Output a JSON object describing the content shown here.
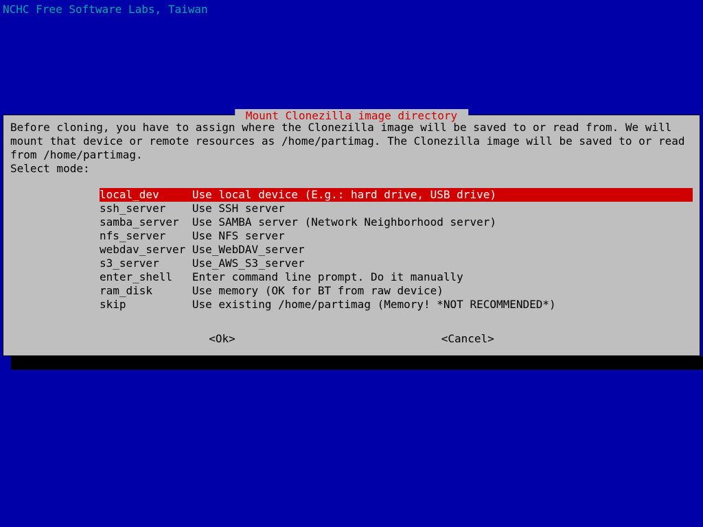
{
  "header": "NCHC Free Software Labs, Taiwan",
  "dialog": {
    "title": " Mount Clonezilla image directory ",
    "body": "Before cloning, you have to assign where the Clonezilla image will be saved to or read from. We will mount that device or remote resources as /home/partimag. The Clonezilla image will be saved to or read from /home/partimag.\nSelect mode:",
    "menu": [
      {
        "key": "local_dev",
        "desc": "Use local device (E.g.: hard drive, USB drive)",
        "selected": true
      },
      {
        "key": "ssh_server",
        "desc": "Use SSH server",
        "selected": false
      },
      {
        "key": "samba_server",
        "desc": "Use SAMBA server (Network Neighborhood server)",
        "selected": false
      },
      {
        "key": "nfs_server",
        "desc": "Use NFS server",
        "selected": false
      },
      {
        "key": "webdav_server",
        "desc": "Use_WebDAV_server",
        "selected": false
      },
      {
        "key": "s3_server",
        "desc": "Use_AWS_S3_server",
        "selected": false
      },
      {
        "key": "enter_shell",
        "desc": "Enter command line prompt. Do it manually",
        "selected": false
      },
      {
        "key": "ram_disk",
        "desc": "Use memory (OK for BT from raw device)",
        "selected": false
      },
      {
        "key": "skip",
        "desc": "Use existing /home/partimag (Memory! *NOT RECOMMENDED*)",
        "selected": false
      }
    ],
    "buttons": {
      "ok": "<Ok>",
      "cancel": "<Cancel>"
    }
  }
}
